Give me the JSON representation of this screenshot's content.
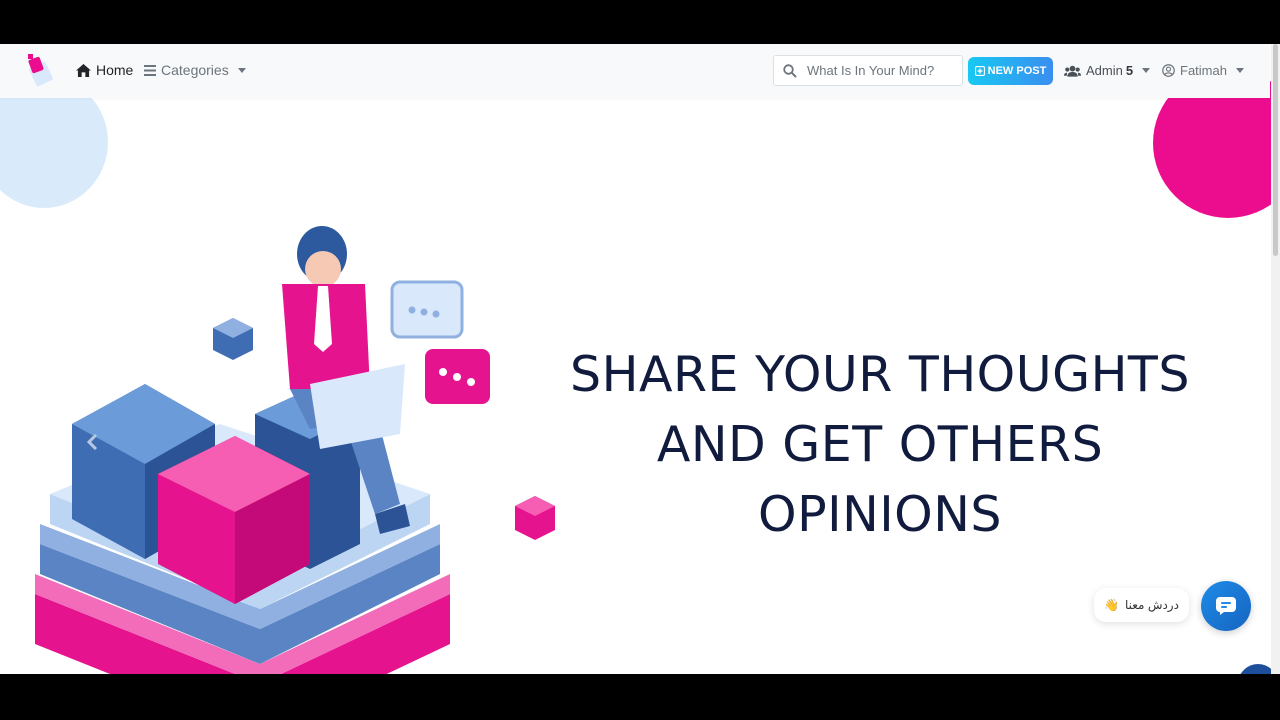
{
  "navbar": {
    "home_label": "Home",
    "categories_label": "Categories",
    "search_placeholder": "What Is In Your Mind?",
    "new_post_label": "NEW POST",
    "admin_label": "Admin",
    "admin_count": "5",
    "user_label": "Fatimah"
  },
  "hero": {
    "headline_line1": "SHARE YOUR THOUGHTS",
    "headline_line2": "AND GET OTHERS",
    "headline_line3": "OPINIONS"
  },
  "chat": {
    "bubble_text": "دردش معنا",
    "bubble_emoji": "👋"
  },
  "colors": {
    "brand_pink": "#ec0d8f",
    "brand_blue": "#3a8ef0",
    "headline": "#101b3e"
  },
  "icons": [
    "logo-icon",
    "home-icon",
    "bars-icon",
    "search-icon",
    "plus-square-icon",
    "users-icon",
    "user-circle-icon",
    "chat-icon",
    "chevron-left-icon"
  ]
}
